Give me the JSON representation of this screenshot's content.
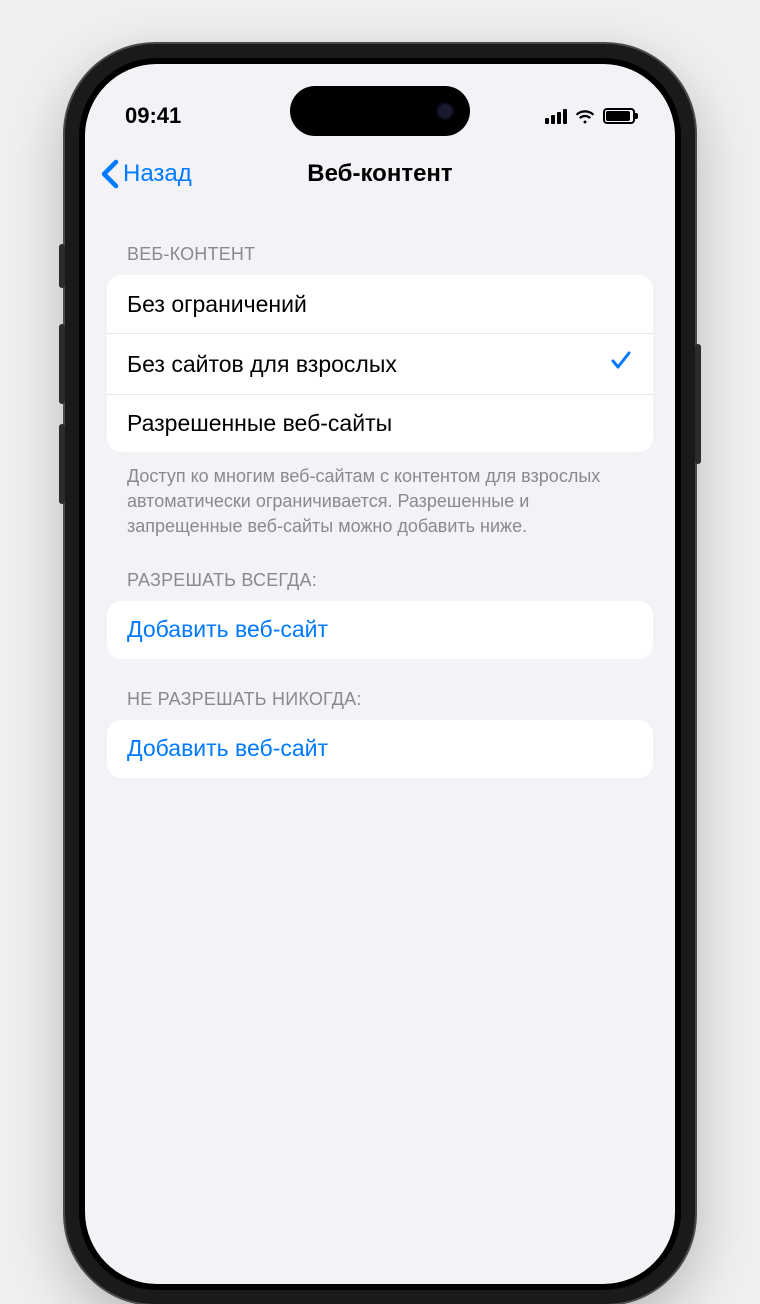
{
  "status": {
    "time": "09:41"
  },
  "nav": {
    "back_label": "Назад",
    "title": "Веб-контент"
  },
  "section_web": {
    "header": "ВЕБ-КОНТЕНТ",
    "options": [
      {
        "label": "Без ограничений",
        "selected": false
      },
      {
        "label": "Без сайтов для взрослых",
        "selected": true
      },
      {
        "label": "Разрешенные веб-сайты",
        "selected": false
      }
    ],
    "footer": "Доступ ко многим веб-сайтам с контентом для взрослых автоматически ограничивается. Разрешенные и запрещенные веб-сайты можно добавить ниже."
  },
  "section_allow": {
    "header": "РАЗРЕШАТЬ ВСЕГДА:",
    "add_label": "Добавить веб-сайт"
  },
  "section_never": {
    "header": "НЕ РАЗРЕШАТЬ НИКОГДА:",
    "add_label": "Добавить веб-сайт"
  }
}
